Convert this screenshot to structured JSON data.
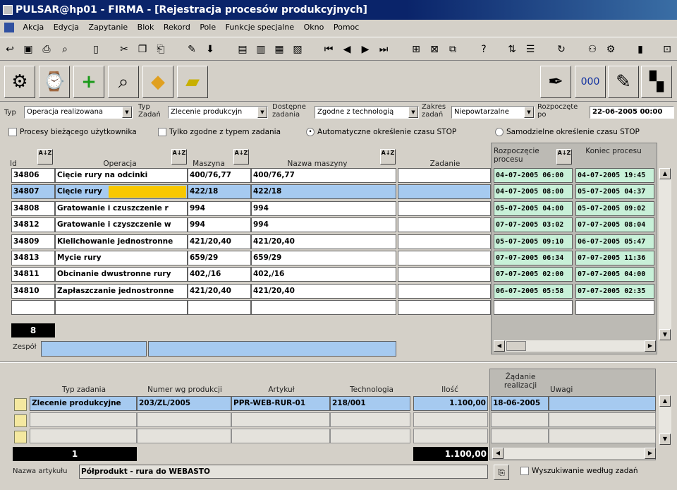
{
  "window": {
    "title": "PULSAR@hp01 - FIRMA - [Rejestracja procesów produkcyjnych]"
  },
  "menu": [
    "Akcja",
    "Edycja",
    "Zapytanie",
    "Blok",
    "Rekord",
    "Pole",
    "Funkcje specjalne",
    "Okno",
    "Pomoc"
  ],
  "filters": {
    "typ_label": "Typ",
    "typ_value": "Operacja realizowana",
    "typ_zadan_label": "Typ Zadań",
    "typ_zadan_value": "Zlecenie produkcyjn",
    "dostepne_label": "Dostępne zadania",
    "dostepne_value": "Zgodne z technologią",
    "zakres_label": "Zakres zadań",
    "zakres_value": "Niepowtarzalne",
    "rozpoczete_label": "Rozpoczęte po",
    "rozpoczete_value": "22-06-2005 00:00"
  },
  "checks": {
    "c1": "Procesy bieżącego użytkownika",
    "c2": "Tylko zgodne z typem zadania",
    "c3": "Automatyczne określenie czasu STOP",
    "c4": "Samodzielne określenie czasu STOP"
  },
  "grid": {
    "headers": {
      "id": "Id",
      "operacja": "Operacja",
      "maszyna": "Maszyna",
      "nazwa_maszyny": "Nazwa maszyny",
      "zadanie": "Zadanie",
      "rozpoczecie": "Rozpoczęcie procesu",
      "koniec": "Koniec procesu"
    },
    "sort_glyph": "A↓Z",
    "rows": [
      {
        "id": "34806",
        "op": "Cięcie rury na odcinki",
        "m": "400/76,77",
        "nm": "400/76,77",
        "start": "04-07-2005 06:00",
        "end": "04-07-2005 19:45"
      },
      {
        "id": "34807",
        "op": "Cięcie rury",
        "m": "422/18",
        "nm": "422/18",
        "start": "04-07-2005 08:00",
        "end": "05-07-2005 04:37"
      },
      {
        "id": "34808",
        "op": "Gratowanie i  czuszczenie r",
        "m": "994",
        "nm": "994",
        "start": "05-07-2005 04:00",
        "end": "05-07-2005 09:02"
      },
      {
        "id": "34812",
        "op": "Gratowanie i czyszczenie w",
        "m": "994",
        "nm": "994",
        "start": "07-07-2005 03:02",
        "end": "07-07-2005 08:04"
      },
      {
        "id": "34809",
        "op": "Kielichowanie jednostronne",
        "m": "421/20,40",
        "nm": "421/20,40",
        "start": "05-07-2005 09:10",
        "end": "06-07-2005 05:47"
      },
      {
        "id": "34813",
        "op": "Mycie rury",
        "m": "659/29",
        "nm": "659/29",
        "start": "07-07-2005 06:34",
        "end": "07-07-2005 11:36"
      },
      {
        "id": "34811",
        "op": "Obcinanie dwustronne rury",
        "m": "402,/16",
        "nm": "402,/16",
        "start": "07-07-2005 02:00",
        "end": "07-07-2005 04:00"
      },
      {
        "id": "34810",
        "op": "Zapłaszczanie jednostronne",
        "m": "421/20,40",
        "nm": "421/20,40",
        "start": "06-07-2005 05:58",
        "end": "07-07-2005 02:35"
      }
    ],
    "count": "8",
    "zespol_label": "Zespół"
  },
  "lower": {
    "headers": {
      "typ": "Typ zadania",
      "numer": "Numer wg produkcji",
      "artykul": "Artykuł",
      "technologia": "Technologia",
      "ilosc": "Ilość",
      "zadanie_real": "Żądanie realizacji",
      "uwagi": "Uwagi"
    },
    "row": {
      "typ": "Zlecenie produkcyjne",
      "numer": "203/ZL/2005",
      "artykul": "PPR-WEB-RUR-01",
      "technologia": "218/001",
      "ilosc": "1.100,00",
      "data": "18-06-2005"
    },
    "count": "1",
    "sum": "1.100,00",
    "nazwa_label": "Nazwa artykułu",
    "nazwa_value": "Półprodukt - rura do WEBASTO",
    "wyszukiwanie": "Wyszukiwanie według zadań"
  },
  "colors": {
    "selected": "#a6caf0",
    "green": "#c8f0d8",
    "titlebar": "#0a246a"
  }
}
